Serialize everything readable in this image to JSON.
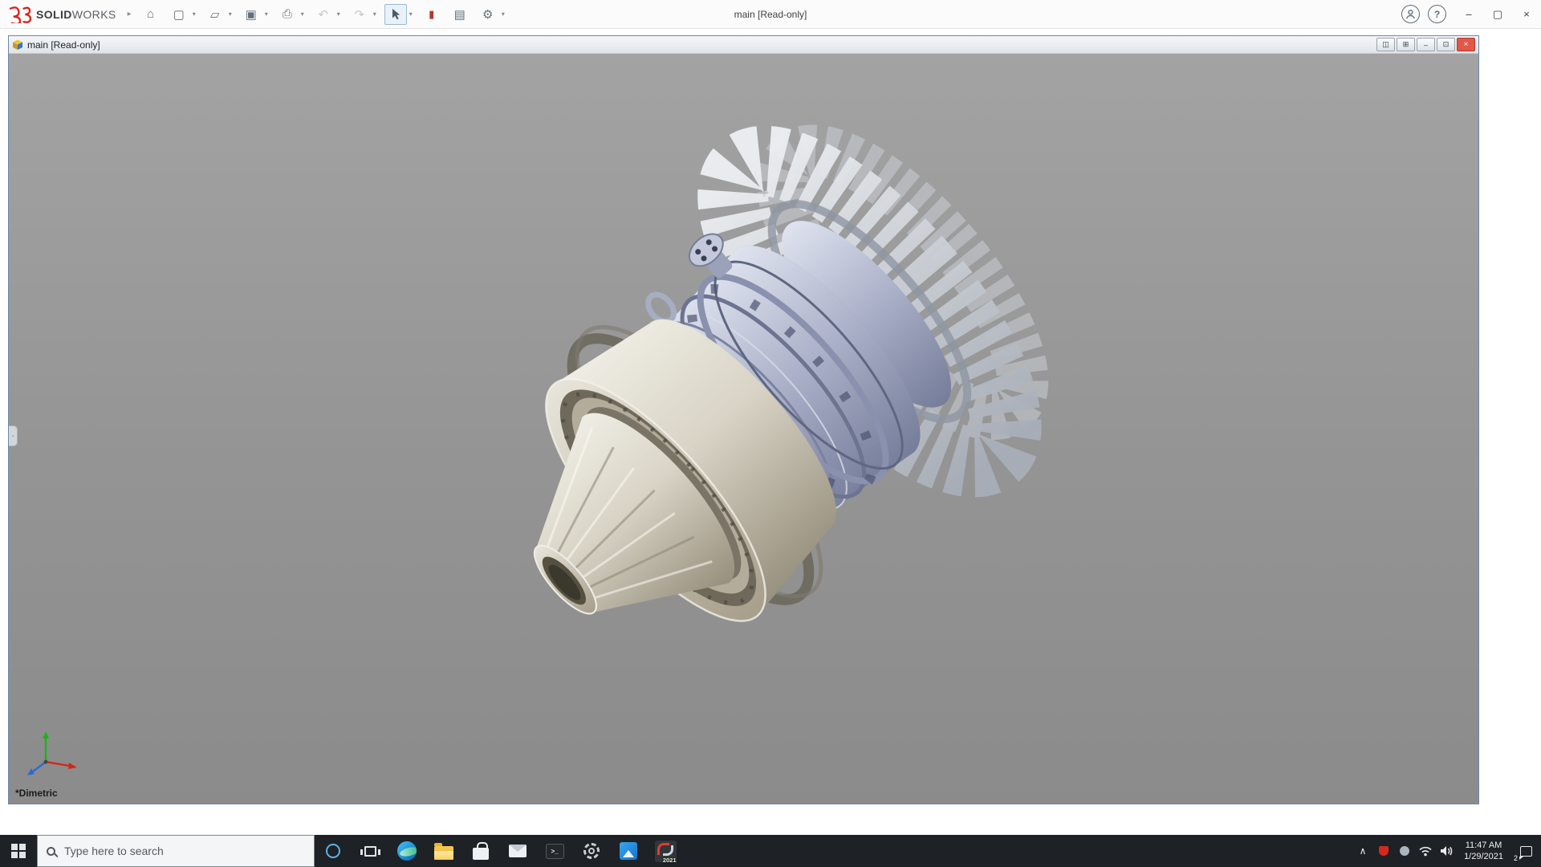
{
  "colors": {
    "brand_red": "#d9261c",
    "taskbar_bg": "#1e2126",
    "doc_close_red": "#e2574a",
    "viewport_gray": "#949494",
    "model_cream": "#d8d3c6",
    "model_steel_blue": "#aab0c8",
    "model_silver": "#d9dce0"
  },
  "icons": {
    "flyout": "▸",
    "home": "⌂",
    "new_doc": "▢",
    "open": "▱",
    "save": "▣",
    "print": "⎙",
    "undo": "↶",
    "redo": "↷",
    "record": "▮",
    "design_binder": "▤",
    "options": "⚙",
    "caret": "▾",
    "help": "?",
    "minimize": "–",
    "maximize": "▢",
    "close": "×",
    "doc_new_window": "◫",
    "doc_tile": "⊞",
    "doc_restore": "⊡",
    "tray_chevron": "∧",
    "terminal_prompt": ">_",
    "collapse_tab": "◦"
  },
  "app": {
    "brand_solid": "SOLID",
    "brand_works": "WORKS",
    "title": "main [Read-only]"
  },
  "document": {
    "title": "main [Read-only]",
    "view_label": "*Dimetric"
  },
  "taskbar": {
    "search_placeholder": "Type here to search",
    "solidworks_year": "2021",
    "tray": {
      "time": "11:47 AM",
      "date": "1/29/2021",
      "badge": "2"
    }
  }
}
